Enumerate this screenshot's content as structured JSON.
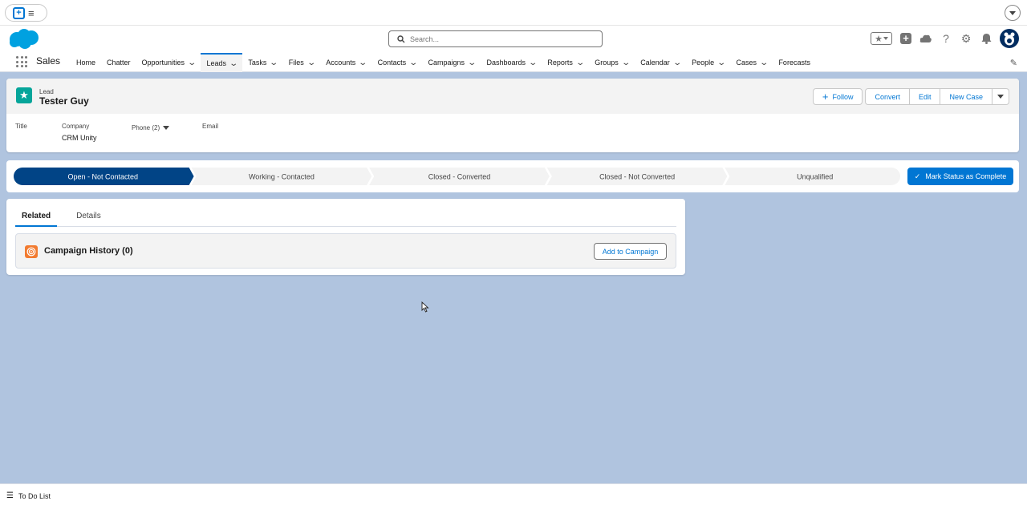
{
  "header": {
    "search_placeholder": "Search..."
  },
  "nav": {
    "app_name": "Sales",
    "items": [
      {
        "label": "Home",
        "dropdown": false
      },
      {
        "label": "Chatter",
        "dropdown": false
      },
      {
        "label": "Opportunities",
        "dropdown": true
      },
      {
        "label": "Leads",
        "dropdown": true,
        "active": true
      },
      {
        "label": "Tasks",
        "dropdown": true
      },
      {
        "label": "Files",
        "dropdown": true
      },
      {
        "label": "Accounts",
        "dropdown": true
      },
      {
        "label": "Contacts",
        "dropdown": true
      },
      {
        "label": "Campaigns",
        "dropdown": true
      },
      {
        "label": "Dashboards",
        "dropdown": true
      },
      {
        "label": "Reports",
        "dropdown": true
      },
      {
        "label": "Groups",
        "dropdown": true
      },
      {
        "label": "Calendar",
        "dropdown": true
      },
      {
        "label": "People",
        "dropdown": true
      },
      {
        "label": "Cases",
        "dropdown": true
      },
      {
        "label": "Forecasts",
        "dropdown": false
      }
    ]
  },
  "record": {
    "entity_type": "Lead",
    "name": "Tester Guy",
    "actions": {
      "follow": "Follow",
      "convert": "Convert",
      "edit": "Edit",
      "new_case": "New Case"
    },
    "fields": [
      {
        "label": "Title",
        "value": ""
      },
      {
        "label": "Company",
        "value": "CRM Unity"
      },
      {
        "label": "Phone (2)",
        "value": ""
      },
      {
        "label": "Email",
        "value": ""
      }
    ]
  },
  "path": {
    "stages": [
      "Open - Not Contacted",
      "Working - Contacted",
      "Closed - Converted",
      "Closed - Not Converted",
      "Unqualified"
    ],
    "current_index": 0,
    "mark_button": "Mark Status as Complete"
  },
  "related": {
    "tabs": [
      "Related",
      "Details"
    ],
    "active_tab": "Related",
    "list_title": "Campaign History (0)",
    "list_button": "Add to Campaign"
  },
  "utility_bar": {
    "todo_label": "To Do List"
  },
  "colors": {
    "brand": "#0176d3",
    "path_current": "#014486",
    "lead_icon": "#06a59a",
    "campaign_icon": "#f27b30",
    "background": "#b0c4df"
  }
}
